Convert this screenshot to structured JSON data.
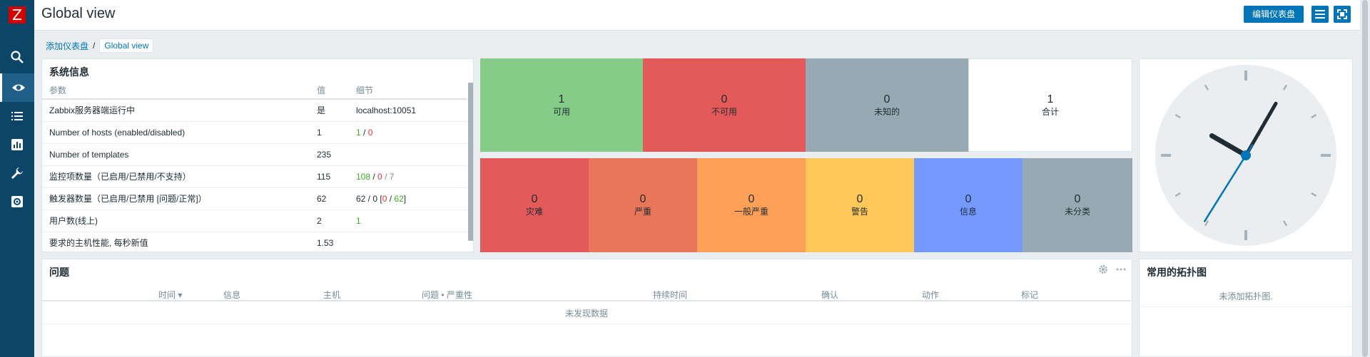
{
  "sidebar": {
    "logo": "Z",
    "items": [
      {
        "icon": "search-icon"
      },
      {
        "icon": "eye-icon"
      },
      {
        "icon": "list-icon"
      },
      {
        "icon": "chart-icon"
      },
      {
        "icon": "wrench-icon"
      },
      {
        "icon": "gear-icon"
      }
    ]
  },
  "header": {
    "title": "Global view",
    "edit_button": "编辑仪表盘"
  },
  "breadcrumb": {
    "parent": "添加仪表盘",
    "separator": "/",
    "current": "Global view"
  },
  "system_info": {
    "title": "系统信息",
    "columns": [
      "参数",
      "值",
      "细节"
    ],
    "rows": [
      {
        "param": "Zabbix服务器端运行中",
        "value": "是",
        "detail_a": "localhost:10051",
        "detail_b": "",
        "detail_c": "",
        "detail_d": ""
      },
      {
        "param": "Number of hosts (enabled/disabled)",
        "value": "1",
        "detail_a": "1",
        "detail_b": " / ",
        "detail_c": "0",
        "detail_d": ""
      },
      {
        "param": "Number of templates",
        "value": "235",
        "detail_a": "",
        "detail_b": "",
        "detail_c": "",
        "detail_d": ""
      },
      {
        "param": "监控项数量（已启用/已禁用/不支持）",
        "value": "115",
        "detail_a": "108",
        "detail_b": " / ",
        "detail_c": "0",
        "detail_d": " / 7"
      },
      {
        "param": "触发器数量（已启用/已禁用 [问题/正常]）",
        "value": "62",
        "detail_a": "62 / 0 [",
        "detail_b": "0",
        "detail_c": " / ",
        "detail_d": "62",
        "detail_e": "]"
      },
      {
        "param": "用户数(线上)",
        "value": "2",
        "detail_a": "1",
        "detail_b": "",
        "detail_c": "",
        "detail_d": ""
      },
      {
        "param": "要求的主机性能, 每秒新值",
        "value": "1.53",
        "detail_a": "",
        "detail_b": "",
        "detail_c": "",
        "detail_d": ""
      }
    ]
  },
  "host_availability": [
    {
      "count": "1",
      "label": "可用",
      "color": "#86cc89"
    },
    {
      "count": "0",
      "label": "不可用",
      "color": "#e45959"
    },
    {
      "count": "0",
      "label": "未知的",
      "color": "#97aab3"
    },
    {
      "count": "1",
      "label": "合计",
      "color": "#ffffff"
    }
  ],
  "problems_by_severity": [
    {
      "count": "0",
      "label": "灾难",
      "color": "#e45959"
    },
    {
      "count": "0",
      "label": "严重",
      "color": "#e97659"
    },
    {
      "count": "0",
      "label": "一般严重",
      "color": "#ffa059"
    },
    {
      "count": "0",
      "label": "警告",
      "color": "#ffc859"
    },
    {
      "count": "0",
      "label": "信息",
      "color": "#7499ff"
    },
    {
      "count": "0",
      "label": "未分类",
      "color": "#97aab3"
    }
  ],
  "problems": {
    "title": "问题",
    "columns": [
      "时间 ▾",
      "信息",
      "主机",
      "问题 • 严重性",
      "持续时间",
      "确认",
      "动作",
      "标记"
    ],
    "empty": "未发现数据"
  },
  "maps": {
    "title": "常用的拓扑图",
    "empty": "未添加拓扑图."
  },
  "clock": {
    "hour_angle": 300,
    "minute_angle": 30,
    "second_angle": 212
  }
}
